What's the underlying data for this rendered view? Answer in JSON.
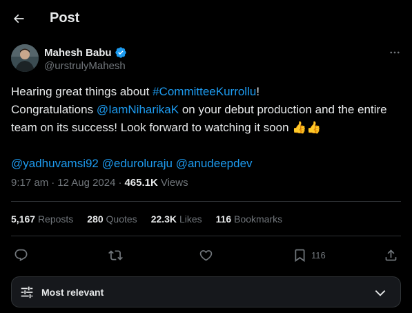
{
  "header": {
    "title": "Post"
  },
  "author": {
    "name": "Mahesh Babu",
    "handle": "@urstrulyMahesh"
  },
  "tweet": {
    "line1_text": "Hearing great things about ",
    "line1_hashtag": "#CommitteeKurrollu",
    "line1_end": "!",
    "line2_text": "Congratulations ",
    "line2_mention": "@IamNiharikaK",
    "line2_end": " on your debut production and the entire",
    "line3_text": "team on its success! Look forward to watching it soon ",
    "line3_emoji": "👍👍",
    "mentions": [
      "@yadhuvamsi92",
      "@eduroluraju",
      "@anudeepdev"
    ]
  },
  "meta": {
    "time": "9:17 am",
    "sep": "·",
    "date": "12 Aug 2024",
    "views_count": "465.1K",
    "views_label": "Views"
  },
  "stats": [
    {
      "count": "5,167",
      "label": "Reposts"
    },
    {
      "count": "280",
      "label": "Quotes"
    },
    {
      "count": "22.3K",
      "label": "Likes"
    },
    {
      "count": "116",
      "label": "Bookmarks"
    }
  ],
  "actions": {
    "bookmark_count": "116"
  },
  "sort": {
    "label": "Most relevant"
  },
  "colors": {
    "accent": "#1d9bf0",
    "background": "#000000",
    "muted": "#71767b",
    "text": "#e7e9ea"
  }
}
